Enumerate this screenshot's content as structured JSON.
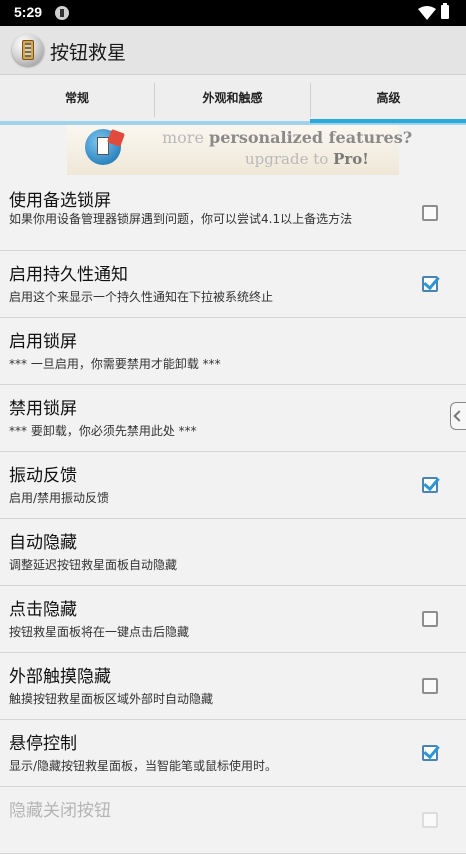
{
  "status": {
    "time": "5:29"
  },
  "app": {
    "title": "按钮救星"
  },
  "tabs": [
    {
      "label": "常规"
    },
    {
      "label": "外观和触感"
    },
    {
      "label": "高级"
    }
  ],
  "promo": {
    "text_more": "more ",
    "text_features": "personalized features?",
    "text_upgrade": "upgrade to ",
    "text_pro": "Pro!"
  },
  "settings": [
    {
      "title": "使用备选锁屏",
      "subtitle": "如果你用设备管理器锁屏遇到问题，你可以尝试4.1以上备选方法",
      "checked": false
    },
    {
      "title": "启用持久性通知",
      "subtitle": "启用这个来显示一个持久性通知在下拉被系统终止",
      "checked": true
    },
    {
      "title": "启用锁屏",
      "subtitle": "*** 一旦启用，你需要禁用才能卸载 ***"
    },
    {
      "title": "禁用锁屏",
      "subtitle": "*** 要卸载，你必须先禁用此处 ***"
    },
    {
      "title": "振动反馈",
      "subtitle": "启用/禁用振动反馈",
      "checked": true
    },
    {
      "title": "自动隐藏",
      "subtitle": "调整延迟按钮救星面板自动隐藏"
    },
    {
      "title": "点击隐藏",
      "subtitle": "按钮救星面板将在一键点击后隐藏",
      "checked": false
    },
    {
      "title": "外部触摸隐藏",
      "subtitle": "触摸按钮救星面板区域外部时自动隐藏",
      "checked": false
    },
    {
      "title": "悬停控制",
      "subtitle": "显示/隐藏按钮救星面板，当智能笔或鼠标使用时。",
      "checked": true
    },
    {
      "title": "隐藏关闭按钮",
      "subtitle": "",
      "checked": false
    }
  ],
  "colors": {
    "accent": "#2ba8dc",
    "check": "#2b96d6"
  }
}
